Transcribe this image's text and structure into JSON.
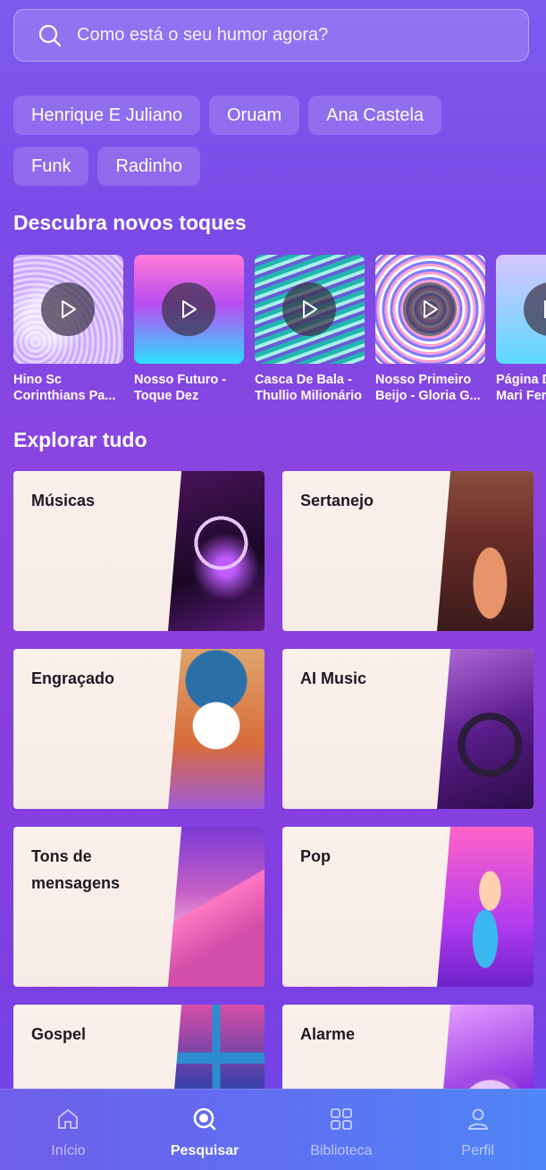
{
  "search": {
    "placeholder": "Como está o seu humor agora?"
  },
  "chips": [
    [
      "Henrique E Juliano",
      "Oruam",
      "Ana Castela"
    ],
    [
      "Funk",
      "Radinho"
    ]
  ],
  "sections": {
    "discover_title": "Descubra novos toques",
    "explore_title": "Explorar tudo"
  },
  "tones": [
    {
      "title": "Hino Sc\nCorinthians Pa..."
    },
    {
      "title": "Nosso Futuro -\nToque Dez"
    },
    {
      "title": "Casca De Bala -\nThullio Milionário"
    },
    {
      "title": "Nosso Primeiro\nBeijo - Gloria G..."
    },
    {
      "title": "Página D\nMari Fer"
    }
  ],
  "categories": [
    {
      "label": "Músicas"
    },
    {
      "label": "Sertanejo"
    },
    {
      "label": "Engraçado"
    },
    {
      "label": "AI Music"
    },
    {
      "label": "Tons de mensagens"
    },
    {
      "label": "Pop"
    },
    {
      "label": "Gospel"
    },
    {
      "label": "Alarme"
    }
  ],
  "tabbar": {
    "items": [
      {
        "label": "Início",
        "icon": "home-icon"
      },
      {
        "label": "Pesquisar",
        "icon": "search-icon"
      },
      {
        "label": "Biblioteca",
        "icon": "library-grid-icon"
      },
      {
        "label": "Perfil",
        "icon": "person-icon"
      }
    ],
    "active_index": 1
  }
}
